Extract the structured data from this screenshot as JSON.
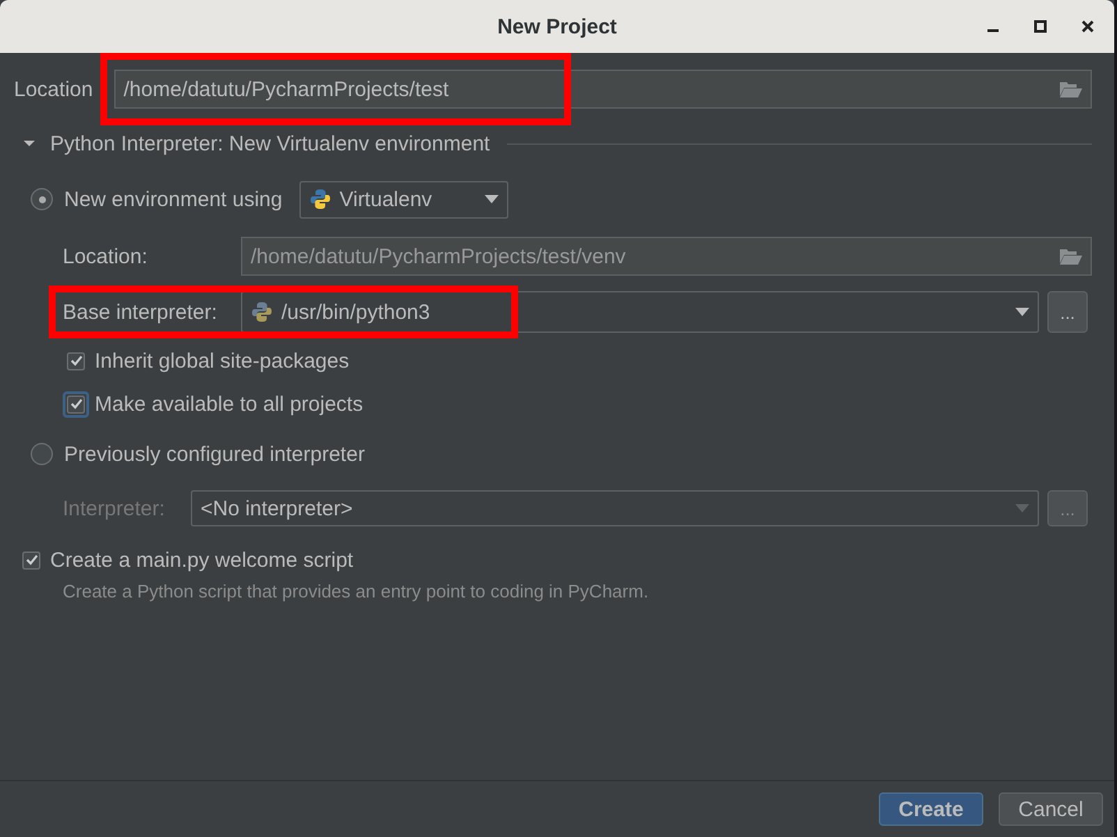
{
  "window": {
    "title": "New Project"
  },
  "location": {
    "label": "Location",
    "value": "/home/datutu/PycharmProjects/test",
    "highlighted": true
  },
  "interpreter_section": {
    "title": "Python Interpreter: New Virtualenv environment",
    "expanded": true
  },
  "new_environment": {
    "label": "New environment using",
    "selected": true,
    "tool": "Virtualenv",
    "location": {
      "label": "Location:",
      "value": "/home/datutu/PycharmProjects/test/venv"
    },
    "base_interpreter": {
      "label": "Base interpreter:",
      "value": "/usr/bin/python3",
      "highlighted": true,
      "browse": "..."
    },
    "options": [
      {
        "label": "Inherit global site-packages",
        "checked": true,
        "focused": false
      },
      {
        "label": "Make available to all projects",
        "checked": true,
        "focused": true
      }
    ]
  },
  "existing_interpreter": {
    "label": "Previously configured interpreter",
    "selected": false,
    "interpreter": {
      "label": "Interpreter:",
      "value": "<No interpreter>",
      "disabled": true,
      "browse": "..."
    }
  },
  "welcome_script": {
    "label": "Create a main.py welcome script",
    "checked": true,
    "description": "Create a Python script that provides an entry point to coding in PyCharm."
  },
  "buttons": [
    {
      "label": "Create",
      "kind": "primary"
    },
    {
      "label": "Cancel",
      "kind": "secondary"
    }
  ]
}
